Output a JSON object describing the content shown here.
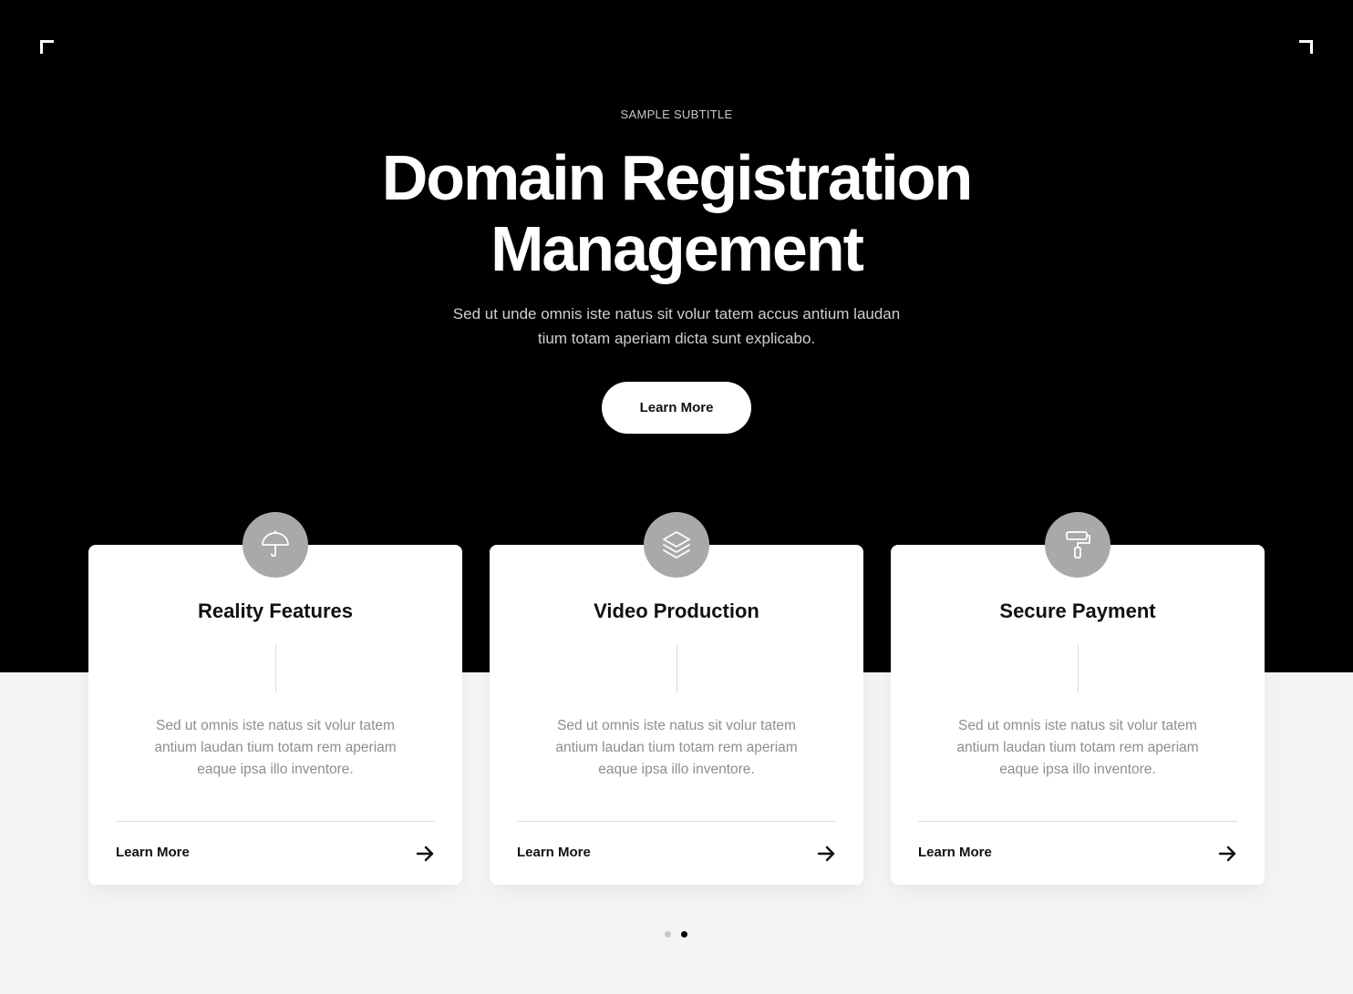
{
  "hero": {
    "subtitle": "SAMPLE SUBTITLE",
    "title_line_1": "Domain Registration",
    "title_line_2": "Management",
    "description_line_1": "Sed ut unde omnis iste natus sit volur tatem accus antium laudan",
    "description_line_2": "tium totam aperiam dicta sunt explicabo.",
    "button_label": "Learn More"
  },
  "cards": [
    {
      "icon": "umbrella-icon",
      "title": "Reality Features",
      "text_line_1": "Sed ut omnis iste natus sit volur tatem",
      "text_line_2": "antium laudan tium totam rem aperiam",
      "text_line_3": "eaque ipsa illo inventore.",
      "link_label": "Learn More"
    },
    {
      "icon": "layers-icon",
      "title": "Video Production",
      "text_line_1": "Sed ut omnis iste natus sit volur tatem",
      "text_line_2": "antium laudan tium totam rem aperiam",
      "text_line_3": "eaque ipsa illo inventore.",
      "link_label": "Learn More"
    },
    {
      "icon": "paint-roller-icon",
      "title": "Secure Payment",
      "text_line_1": "Sed ut omnis iste natus sit volur tatem",
      "text_line_2": "antium laudan tium totam rem aperiam",
      "text_line_3": "eaque ipsa illo inventore.",
      "link_label": "Learn More"
    }
  ],
  "pagination": {
    "total_pages": 2,
    "active_page": 2
  },
  "colors": {
    "hero_background": "#000000",
    "page_background": "#f4f4f4",
    "card_background": "#ffffff",
    "icon_circle": "#a9a9a9",
    "accent_text": "#111111",
    "muted_text": "#8e8e8e"
  }
}
